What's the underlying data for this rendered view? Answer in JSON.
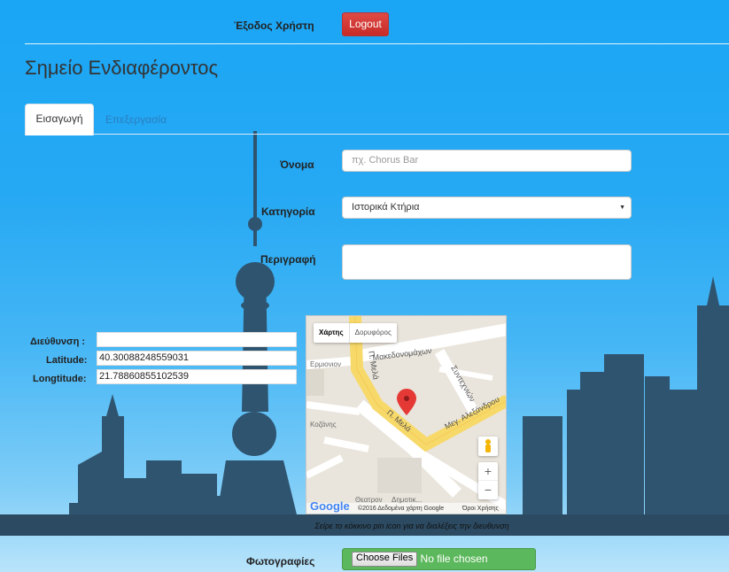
{
  "header": {
    "user_logout_label": "Έξοδος Χρήστη",
    "logout_button": "Logout"
  },
  "page_title": "Σημείο Ενδιαφέροντος",
  "tabs": [
    {
      "label": "Εισαγωγή",
      "active": true
    },
    {
      "label": "Επεξεργασία",
      "active": false
    }
  ],
  "form": {
    "name_label": "Όνομα",
    "name_placeholder": "πχ. Chorus Bar",
    "category_label": "Κατηγορία",
    "category_value": "Ιστορικά Κτήρια",
    "description_label": "Περιγραφή",
    "address_label": "Διεύθυνση :",
    "address_value": "",
    "latitude_label": "Latitude:",
    "latitude_value": "40.30088248559031",
    "longitude_label": "Longtitude:",
    "longitude_value": "21.78860855102539",
    "photos_label": "Φωτογραφίες",
    "choose_files": "Choose Files",
    "no_file": "No file chosen"
  },
  "map": {
    "type_map": "Χάρτης",
    "type_satellite": "Δορυφόρος",
    "streets": [
      "Π. Μελά",
      "Μακεδονομάχων",
      "Συντεχνιών",
      "Μεγ. Αλεξάνδρου",
      "Κοζάνης",
      "Ερμιονιον",
      "Θεατρον"
    ],
    "poi": "Δημοτικ...",
    "google": "Google",
    "attribution": "©2016 Δεδομένα χάρτη Google",
    "terms": "Όροι Χρήσης",
    "zoom_in": "+",
    "zoom_out": "−"
  },
  "hint": "Σείρε το κόκκινο pin icon για να διαλέξεις την διευθυνση",
  "colors": {
    "sky": "#1aa6f5",
    "skyline": "#2f5470",
    "logout": "#d9534f",
    "file_button": "#5cb85c",
    "pin": "#e53935"
  }
}
